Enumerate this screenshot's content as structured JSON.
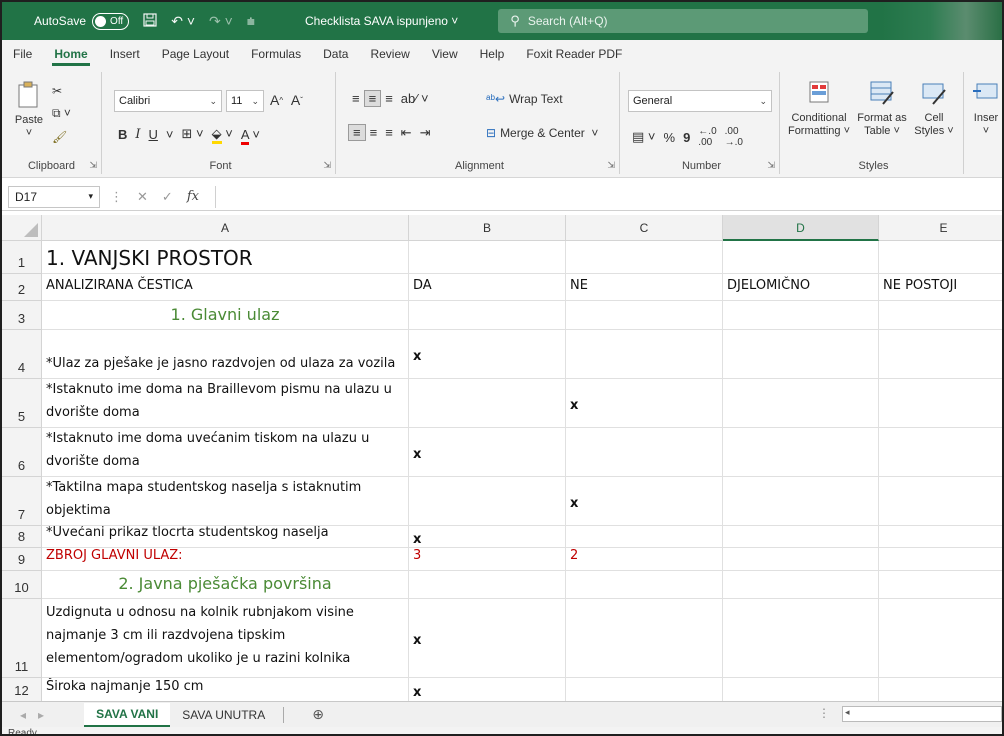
{
  "titlebar": {
    "autosave_label": "AutoSave",
    "autosave_state": "Off",
    "doc_title": "Checklista SAVA ispunjeno",
    "search_placeholder": "Search (Alt+Q)"
  },
  "menu": [
    "File",
    "Home",
    "Insert",
    "Page Layout",
    "Formulas",
    "Data",
    "Review",
    "View",
    "Help",
    "Foxit Reader PDF"
  ],
  "ribbon": {
    "clipboard": {
      "paste": "Paste",
      "label": "Clipboard"
    },
    "font": {
      "name": "Calibri",
      "size": "11",
      "label": "Font",
      "bold": "B",
      "italic": "I",
      "underline": "U"
    },
    "alignment": {
      "wrap_text": "Wrap Text",
      "merge_center": "Merge & Center",
      "label": "Alignment"
    },
    "number": {
      "format": "General",
      "label": "Number",
      "percent": "%",
      "comma": "9"
    },
    "styles": {
      "conditional": "Conditional",
      "conditional2": "Formatting",
      "format_as": "Format as",
      "format_as2": "Table",
      "cell": "Cell",
      "cell2": "Styles",
      "label": "Styles"
    },
    "cells": {
      "insert": "Inser"
    }
  },
  "formula_bar": {
    "name_box": "D17",
    "fx": "fx",
    "value": ""
  },
  "grid": {
    "columns": [
      "A",
      "B",
      "C",
      "D",
      "E"
    ],
    "rows": [
      {
        "n": "1",
        "a": "1. VANJSKI PROSTOR",
        "b": "",
        "c": "",
        "d": "",
        "e": ""
      },
      {
        "n": "2",
        "a": "ANALIZIRANA ČESTICA",
        "b": "DA",
        "c": "NE",
        "d": "DJELOMIČNO",
        "e": "NE POSTOJI"
      },
      {
        "n": "3",
        "a": "1. Glavni ulaz",
        "b": "",
        "c": "",
        "d": "",
        "e": ""
      },
      {
        "n": "4",
        "a": "*Ulaz za pješake je jasno razdvojen od ulaza za vozila",
        "b": "x",
        "c": "",
        "d": "",
        "e": ""
      },
      {
        "n": "5",
        "a": "*Istaknuto ime doma na Braillevom pismu na ulazu u dvorište doma",
        "b": "",
        "c": "x",
        "d": "",
        "e": ""
      },
      {
        "n": "6",
        "a": "*Istaknuto ime doma uvećanim tiskom na ulazu u dvorište doma",
        "b": "x",
        "c": "",
        "d": "",
        "e": ""
      },
      {
        "n": "7",
        "a": "*Taktilna mapa studentskog naselja s istaknutim objektima",
        "b": "",
        "c": "x",
        "d": "",
        "e": ""
      },
      {
        "n": "8",
        "a": "*Uvećani prikaz tlocrta studentskog naselja",
        "b": "x",
        "c": "",
        "d": "",
        "e": ""
      },
      {
        "n": "9",
        "a": "ZBROJ GLAVNI ULAZ:",
        "b": "3",
        "c": "2",
        "d": "",
        "e": ""
      },
      {
        "n": "10",
        "a": "2. Javna pješačka površina",
        "b": "",
        "c": "",
        "d": "",
        "e": ""
      },
      {
        "n": "11",
        "a": "Uzdignuta u odnosu na kolnik rubnjakom visine najmanje 3 cm ili razdvojena tipskim elementom/ogradom ukoliko je u razini kolnika",
        "b": "x",
        "c": "",
        "d": "",
        "e": ""
      },
      {
        "n": "12",
        "a": "Široka najmanje 150 cm",
        "b": "x",
        "c": "",
        "d": "",
        "e": ""
      }
    ]
  },
  "sheets": [
    "SAVA VANI",
    "SAVA UNUTRA"
  ],
  "status": "Ready"
}
